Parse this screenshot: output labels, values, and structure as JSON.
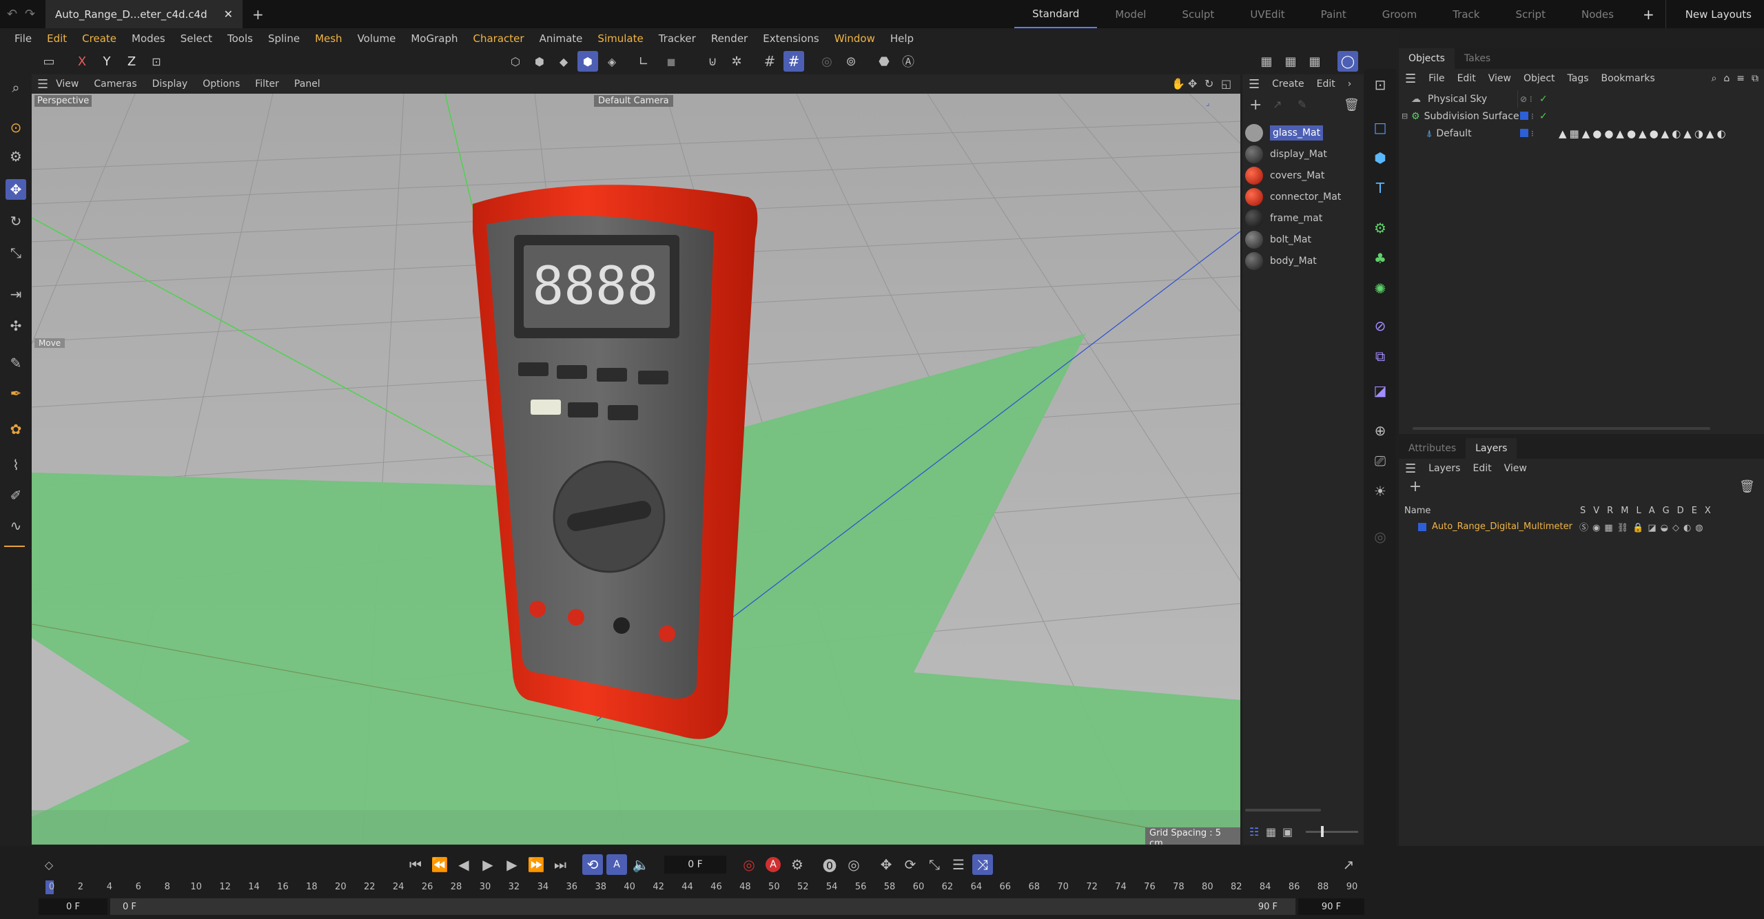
{
  "window": {
    "doc_tab": "Auto_Range_D...eter_c4d.c4d",
    "layouts": [
      "Standard",
      "Model",
      "Sculpt",
      "UVEdit",
      "Paint",
      "Groom",
      "Track",
      "Script",
      "Nodes"
    ],
    "active_layout": "Standard",
    "new_layouts": "New Layouts"
  },
  "menu": [
    "File",
    "Edit",
    "Create",
    "Modes",
    "Select",
    "Tools",
    "Spline",
    "Mesh",
    "Volume",
    "MoGraph",
    "Character",
    "Animate",
    "Simulate",
    "Tracker",
    "Render",
    "Extensions",
    "Window",
    "Help"
  ],
  "viewport": {
    "menu": [
      "View",
      "Cameras",
      "Display",
      "Options",
      "Filter",
      "Panel"
    ],
    "label": "Perspective",
    "camera": "Default Camera",
    "tool_label": "Move",
    "grid_spacing": "Grid Spacing : 5 cm",
    "display_text": "8888"
  },
  "axis_buttons": [
    "X",
    "Y",
    "Z"
  ],
  "materials": {
    "menu": [
      "Create",
      "Edit"
    ],
    "items": [
      {
        "name": "glass_Mat",
        "color": "#9a9a9a"
      },
      {
        "name": "display_Mat",
        "color": "#3a3a3a"
      },
      {
        "name": "covers_Mat",
        "color": "#d42a1a"
      },
      {
        "name": "connector_Mat",
        "color": "#d42a1a"
      },
      {
        "name": "frame_mat",
        "color": "#1e1e1e"
      },
      {
        "name": "bolt_Mat",
        "color": "#404040"
      },
      {
        "name": "body_Mat",
        "color": "#333333"
      }
    ],
    "selected": "glass_Mat"
  },
  "objects": {
    "tabs": [
      "Objects",
      "Takes"
    ],
    "menu": [
      "File",
      "Edit",
      "View",
      "Object",
      "Tags",
      "Bookmarks"
    ],
    "items": [
      {
        "name": "Physical Sky",
        "indent": 0
      },
      {
        "name": "Subdivision Surface",
        "indent": 0
      },
      {
        "name": "Default",
        "indent": 1
      }
    ]
  },
  "layers": {
    "tabs": [
      "Attributes",
      "Layers"
    ],
    "menu": [
      "Layers",
      "Edit",
      "View"
    ],
    "columns_label": "Name",
    "flag_columns": [
      "S",
      "V",
      "R",
      "M",
      "L",
      "A",
      "G",
      "D",
      "E",
      "X"
    ],
    "items": [
      {
        "name": "Auto_Range_Digital_Multimeter",
        "color": "#2d5fd6"
      }
    ]
  },
  "timeline": {
    "current_frame": "0 F",
    "start": "0 F",
    "start2": "0 F",
    "end": "90 F",
    "end2": "90 F",
    "ticks": [
      "0",
      "2",
      "4",
      "6",
      "8",
      "10",
      "12",
      "14",
      "16",
      "18",
      "20",
      "22",
      "24",
      "26",
      "28",
      "30",
      "32",
      "34",
      "36",
      "38",
      "40",
      "42",
      "44",
      "46",
      "48",
      "50",
      "52",
      "54",
      "56",
      "58",
      "60",
      "62",
      "64",
      "66",
      "68",
      "70",
      "72",
      "74",
      "76",
      "78",
      "80",
      "82",
      "84",
      "86",
      "88",
      "90"
    ]
  },
  "colors": {
    "accent": "#4d5fb4",
    "grid_floor": "#b9b9b9",
    "green_spot": "#74c27e",
    "red_body": "#e32b12",
    "menu_highlight": "#f2b544",
    "layer_name": "#f2b544"
  }
}
